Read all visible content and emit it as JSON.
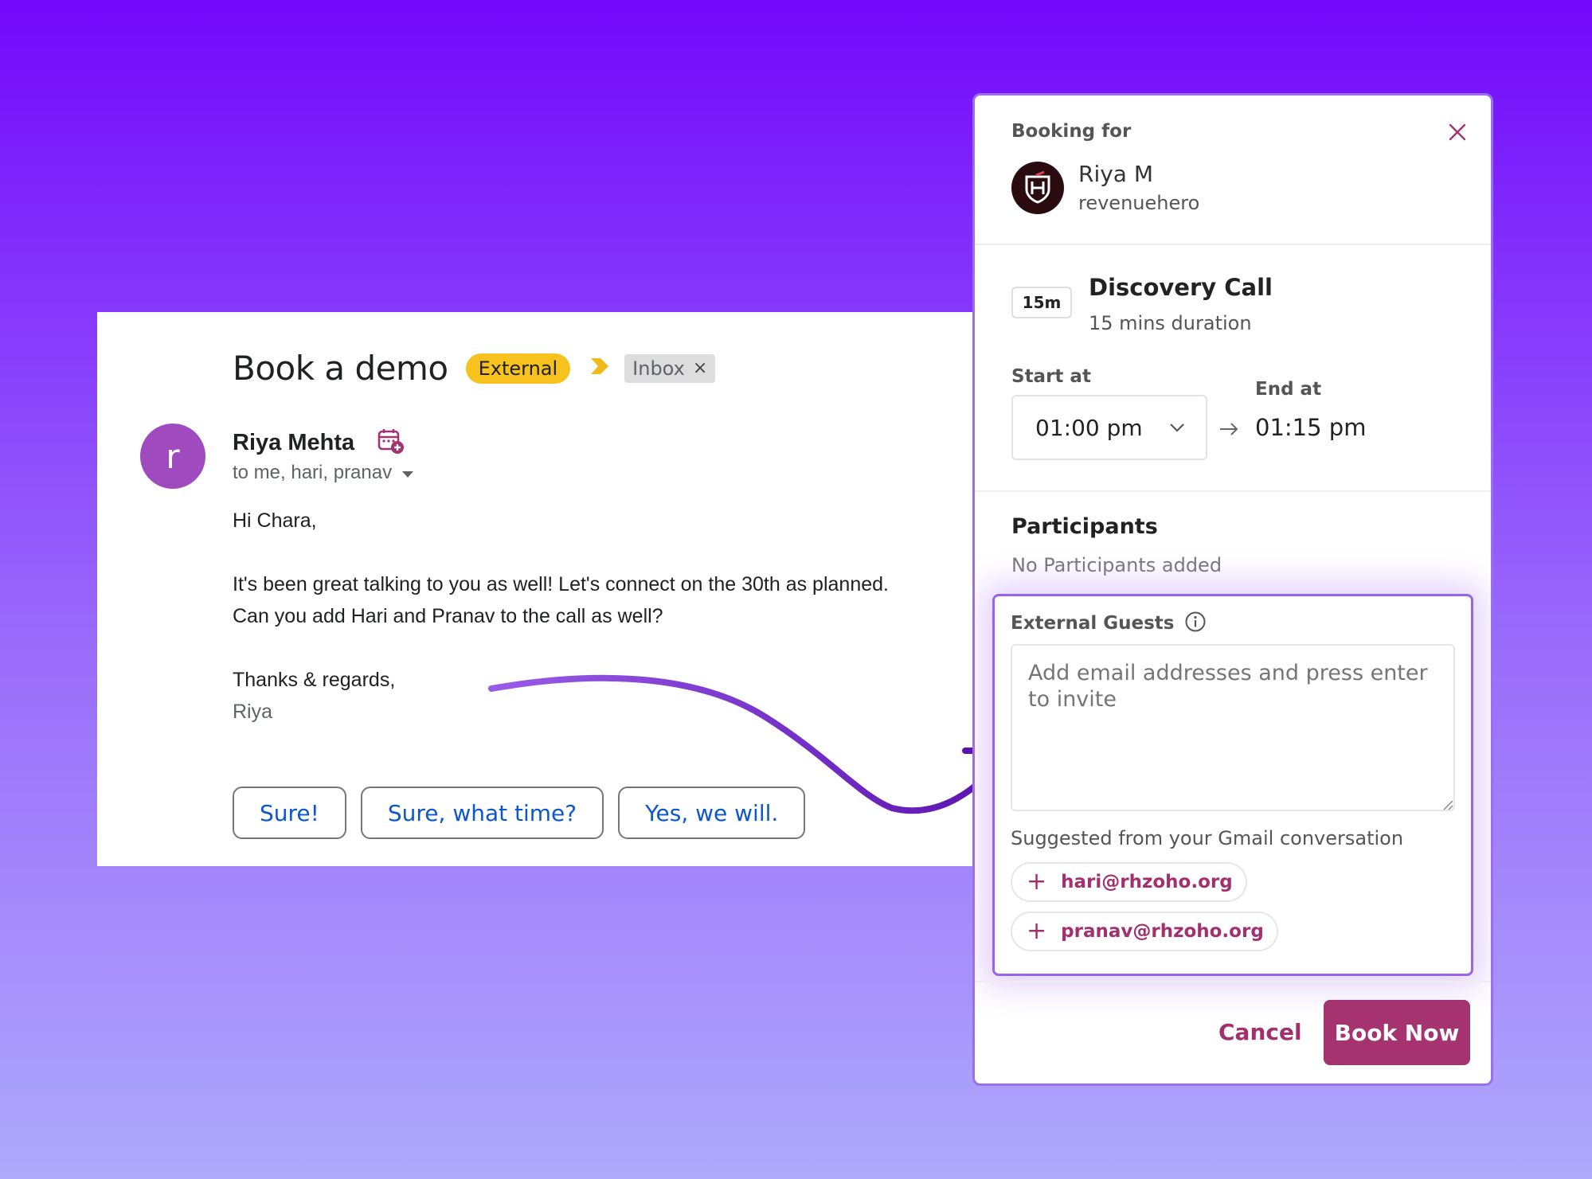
{
  "email": {
    "subject": "Book a demo",
    "labels": {
      "external": "External",
      "inbox": "Inbox",
      "inbox_remove": "×"
    },
    "sender": {
      "avatar_letter": "r",
      "name": "Riya Mehta",
      "recipients": "to me, hari, pranav"
    },
    "body": {
      "greeting": "Hi Chara,",
      "line1": "It's been great talking to you as well! Let's connect on the 30th as planned.",
      "line2": "Can you add Hari and Pranav to the call as well?",
      "signoff": "Thanks & regards,",
      "signature": "Riya"
    },
    "smart_replies": [
      "Sure!",
      "Sure, what time?",
      "Yes, we will."
    ]
  },
  "booking": {
    "section_label": "Booking for",
    "host": {
      "name": "Riya M",
      "org": "revenuehero"
    },
    "meeting": {
      "duration_badge": "15m",
      "title": "Discovery Call",
      "subtitle": "15 mins duration"
    },
    "time": {
      "start_label": "Start at",
      "start_value": "01:00 pm",
      "end_label": "End at",
      "end_value": "01:15 pm"
    },
    "participants": {
      "title": "Participants",
      "empty": "No Participants added"
    },
    "external_guests": {
      "title": "External Guests",
      "placeholder": "Add email addresses and press enter to invite",
      "suggest_label": "Suggested from your Gmail conversation",
      "suggestions": [
        "hari@rhzoho.org",
        "pranav@rhzoho.org"
      ]
    },
    "actions": {
      "cancel": "Cancel",
      "book": "Book Now"
    }
  },
  "colors": {
    "brand": "#a5336f",
    "highlight_border": "#9b62ee",
    "external_label": "#f7c21d",
    "reply_text": "#0b57d0",
    "avatar": "#a04abf"
  },
  "icons": [
    "chevron-label-icon",
    "calendar-add-icon",
    "caret-down-icon",
    "curved-arrow-icon",
    "close-icon",
    "chevron-down-icon",
    "arrow-right-icon",
    "info-icon",
    "plus-icon",
    "resize-grip-icon"
  ]
}
